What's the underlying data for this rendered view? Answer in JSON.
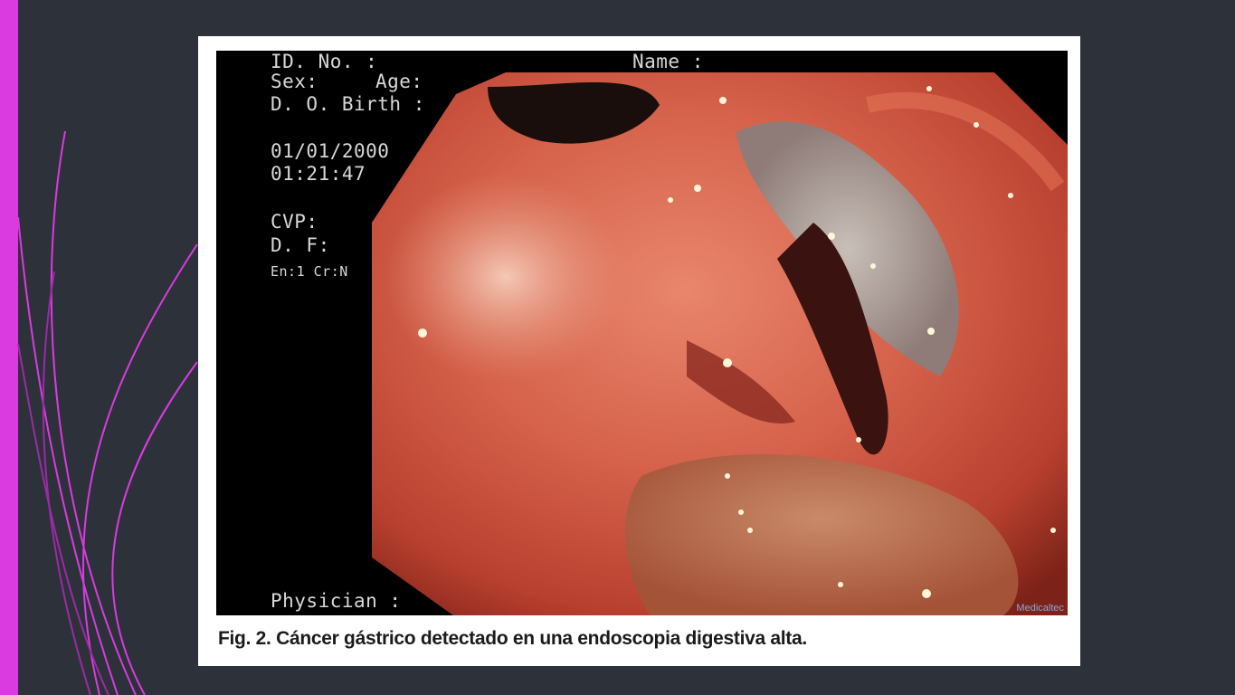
{
  "slide": {
    "accent_color": "#d93be0",
    "background_color": "#2d3139"
  },
  "figure": {
    "osd": {
      "id_no": "ID. No. :",
      "name": "Name :",
      "sex": "Sex:",
      "age": "Age:",
      "dob": "D. O. Birth :",
      "date": "01/01/2000",
      "time": "01:21:47",
      "cvp": "CVP:",
      "df": "D. F:",
      "settings": "En:1 Cr:N",
      "physician": "Physician :"
    },
    "watermark": "Medicaltec",
    "caption": "Fig. 2. Cáncer gástrico detectado en una endoscopia digestiva alta."
  }
}
